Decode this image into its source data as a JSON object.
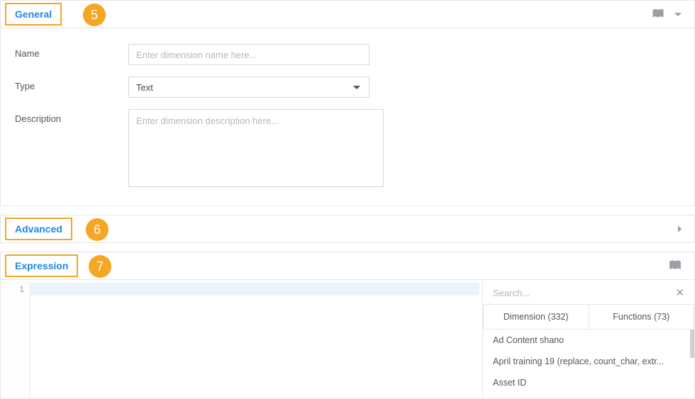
{
  "sections": {
    "general": {
      "title": "General",
      "callout": "5"
    },
    "advanced": {
      "title": "Advanced",
      "callout": "6"
    },
    "expression": {
      "title": "Expression",
      "callout": "7"
    }
  },
  "form": {
    "name_label": "Name",
    "name_placeholder": "Enter dimension name here...",
    "name_value": "",
    "type_label": "Type",
    "type_value": "Text",
    "description_label": "Description",
    "description_placeholder": "Enter dimension description here...",
    "description_value": ""
  },
  "editor": {
    "line_numbers": [
      "1"
    ]
  },
  "side": {
    "search_placeholder": "Search...",
    "tabs": {
      "dimension": {
        "label": "Dimension (332)"
      },
      "functions": {
        "label": "Functions (73)"
      }
    },
    "items": [
      "Ad Content shano",
      "April training 19 (replace, count_char, extr...",
      "Asset ID"
    ]
  }
}
